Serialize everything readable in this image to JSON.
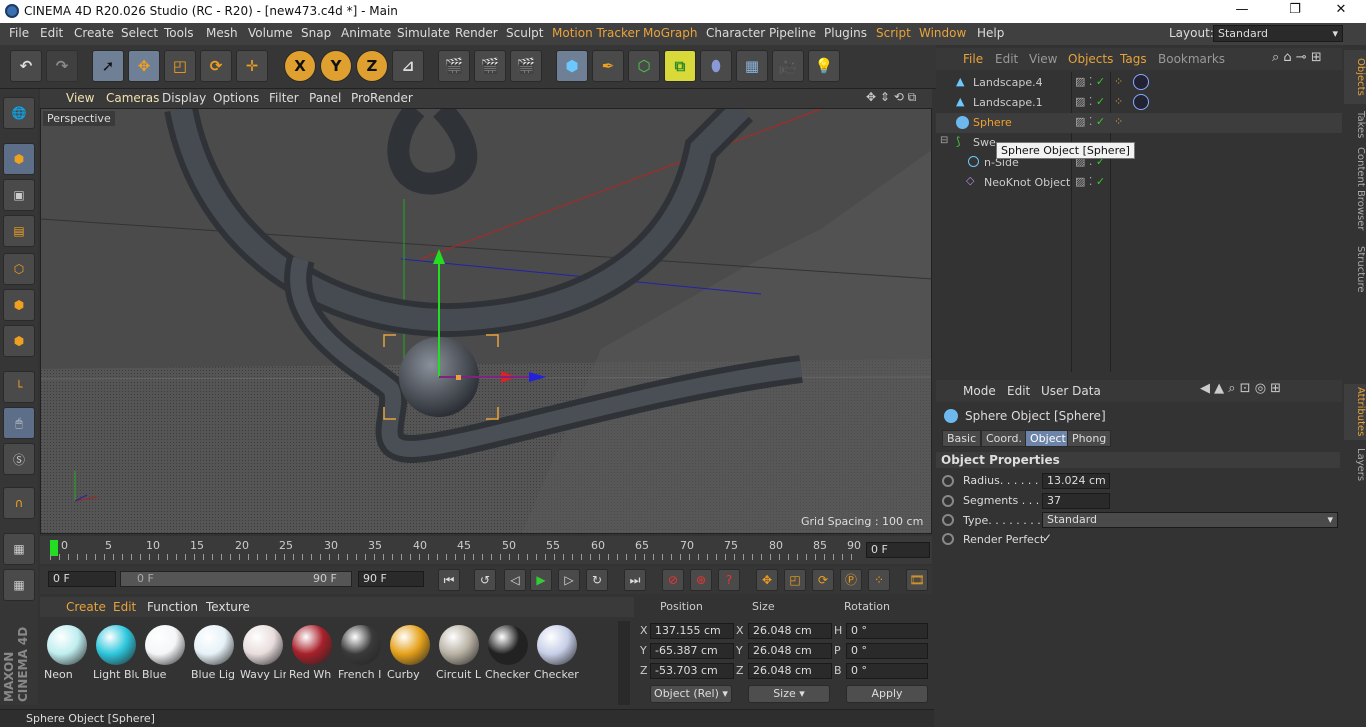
{
  "titlebar": {
    "title": "CINEMA 4D R20.026 Studio (RC - R20) - [new473.c4d *] - Main",
    "minimize": "—",
    "restore": "❐",
    "close": "✕"
  },
  "menu": {
    "items": [
      "File",
      "Edit",
      "Create",
      "Select",
      "Tools",
      "Mesh",
      "Volume",
      "Snap",
      "Animate",
      "Simulate",
      "Render",
      "Sculpt",
      "Motion Tracker",
      "MoGraph",
      "Character",
      "Pipeline",
      "Plugins",
      "Script",
      "Window",
      "Help"
    ],
    "layout_label": "Layout:",
    "layout_value": "Standard"
  },
  "toolbar": {
    "x": "X",
    "y": "Y",
    "z": "Z"
  },
  "viewport": {
    "menu": [
      "View",
      "Cameras",
      "Display",
      "Options",
      "Filter",
      "Panel",
      "ProRender"
    ],
    "label": "Perspective",
    "grid_spacing": "Grid Spacing : 100 cm"
  },
  "timeline": {
    "ticks": [
      "0",
      "5",
      "10",
      "15",
      "20",
      "25",
      "30",
      "35",
      "40",
      "45",
      "50",
      "55",
      "60",
      "65",
      "70",
      "75",
      "80",
      "85",
      "90"
    ],
    "current_frame": "0 F"
  },
  "transport": {
    "start": "0 F",
    "range_start": "0 F",
    "range_end": "90 F",
    "end": "90 F"
  },
  "materials": {
    "menu": [
      "Create",
      "Edit",
      "Function",
      "Texture"
    ],
    "items": [
      {
        "name": "Neon",
        "color": "#bfeef0"
      },
      {
        "name": "Light Blu",
        "color": "#2ec7dd"
      },
      {
        "name": "Blue",
        "color": "#f4f6f8"
      },
      {
        "name": "Blue Lig",
        "color": "#e6f2f8"
      },
      {
        "name": "Wavy Lir",
        "color": "#e9dddd"
      },
      {
        "name": "Red Wh",
        "color": "#a8202a"
      },
      {
        "name": "French I",
        "color": "#3a3a3a"
      },
      {
        "name": "Curby",
        "color": "#e5a11a"
      },
      {
        "name": "Circuit L",
        "color": "#b9b2a4"
      },
      {
        "name": "Checker",
        "color": "#222222"
      },
      {
        "name": "Checker",
        "color": "#c7cfe8"
      }
    ]
  },
  "coords": {
    "headers": [
      "Position",
      "Size",
      "Rotation"
    ],
    "rows": [
      {
        "axis": "X",
        "pos": "137.155 cm",
        "saxis": "X",
        "size": "26.048 cm",
        "raxis": "H",
        "rot": "0 °"
      },
      {
        "axis": "Y",
        "pos": "-65.387 cm",
        "saxis": "Y",
        "size": "26.048 cm",
        "raxis": "P",
        "rot": "0 °"
      },
      {
        "axis": "Z",
        "pos": "-53.703 cm",
        "saxis": "Z",
        "size": "26.048 cm",
        "raxis": "B",
        "rot": "0 °"
      }
    ],
    "mode": "Object (Rel)",
    "size_mode": "Size",
    "apply": "Apply"
  },
  "status": {
    "text": "Sphere Object [Sphere]"
  },
  "objects": {
    "menu": [
      "File",
      "Edit",
      "View",
      "Objects",
      "Tags",
      "Bookmarks"
    ],
    "rows": [
      {
        "name": "Landscape.4"
      },
      {
        "name": "Landscape.1"
      },
      {
        "name": "Sphere"
      },
      {
        "name": "Swe"
      },
      {
        "name": "n-Side"
      },
      {
        "name": "NeoKnot Object"
      }
    ],
    "tooltip": "Sphere Object [Sphere]"
  },
  "right_tabs": [
    "Objects",
    "Takes",
    "Content Browser",
    "Structure"
  ],
  "attr_tabs": [
    "Attributes",
    "Layers"
  ],
  "attributes": {
    "menu": [
      "Mode",
      "Edit",
      "User Data"
    ],
    "object_title": "Sphere Object [Sphere]",
    "tabs": [
      "Basic",
      "Coord.",
      "Object",
      "Phong"
    ],
    "section": "Object Properties",
    "radius_label": "Radius. . . . . .",
    "radius": "13.024 cm",
    "segments_label": "Segments . . . .",
    "segments": "37",
    "type_label": "Type. . . . . . . . .",
    "type": "Standard",
    "render_label": "Render Perfect",
    "render_check": "✓"
  }
}
